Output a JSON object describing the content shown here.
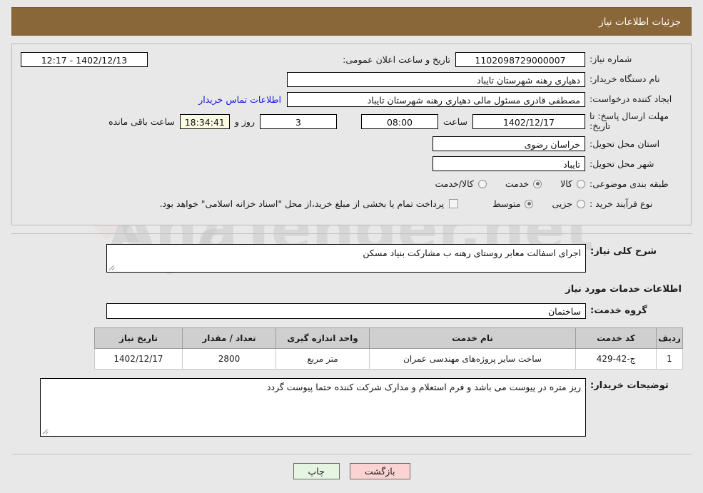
{
  "header": {
    "title": "جزئیات اطلاعات نیاز",
    "bar_color": "#8a6738"
  },
  "fields": {
    "need_number_label": "شماره نیاز:",
    "need_number_value": "1102098729000007",
    "public_announce_label": "تاریخ و ساعت اعلان عمومی:",
    "public_announce_value": "1402/12/13 - 12:17",
    "buyer_org_label": "نام دستگاه خریدار:",
    "buyer_org_value": "دهیاری رهنه  شهرستان تایباد",
    "creator_label": "ایجاد کننده درخواست:",
    "creator_value": "مصطفی قادری مسئول مالی دهیاری رهنه  شهرستان تایباد",
    "contact_link": "اطلاعات تماس خریدار",
    "deadline_label": "مهلت ارسال پاسخ: تا تاریخ:",
    "deadline_date": "1402/12/17",
    "hour_label": "ساعت",
    "deadline_time": "08:00",
    "days_value": "3",
    "days_label": "روز و",
    "countdown_value": "18:34:41",
    "countdown_label": "ساعت باقی مانده",
    "province_label": "استان محل تحویل:",
    "province_value": "خراسان رضوی",
    "city_label": "شهر محل تحویل:",
    "city_value": "تایباد",
    "category_label": "طبقه بندی موضوعی:",
    "process_label": "نوع فرآیند خرید :"
  },
  "category_options": [
    {
      "label": "کالا",
      "selected": false
    },
    {
      "label": "خدمت",
      "selected": true
    },
    {
      "label": "کالا/خدمت",
      "selected": false
    }
  ],
  "process_options": [
    {
      "label": "جزیی",
      "selected": false
    },
    {
      "label": "متوسط",
      "selected": true
    }
  ],
  "payment_note": {
    "checked": false,
    "text": "پرداخت تمام یا بخشی از مبلغ خرید،از محل \"اسناد خزانه اسلامی\" خواهد بود."
  },
  "description": {
    "label": "شرح کلی نیاز:",
    "value": "اجرای اسفالت معابر روستای رهنه ب مشارکت بنیاد مسکن"
  },
  "services_section": {
    "heading": "اطلاعات خدمات مورد نیاز",
    "group_label": "گروه خدمت:",
    "group_value": "ساختمان"
  },
  "table": {
    "headers": [
      "ردیف",
      "کد خدمت",
      "نام خدمت",
      "واحد اندازه گیری",
      "تعداد / مقدار",
      "تاریخ نیاز"
    ],
    "rows": [
      {
        "radif": "1",
        "code": "ج-42-429",
        "name": "ساخت سایر پروژه‌های مهندسی عمران",
        "unit": "متر مربع",
        "qty": "2800",
        "date": "1402/12/17"
      }
    ]
  },
  "buyer_notes": {
    "label": "توضیحات خریدار:",
    "value": "ریز متره در پیوست می باشد و فرم استعلام و مدارک  شرکت کننده حتما پیوست گردد"
  },
  "footer": {
    "back_label": "بازگشت",
    "print_label": "چاپ",
    "back_color": "#fbd3d3",
    "print_color": "#e6f5e2"
  },
  "watermark": {
    "text": "AnaTender.net"
  }
}
